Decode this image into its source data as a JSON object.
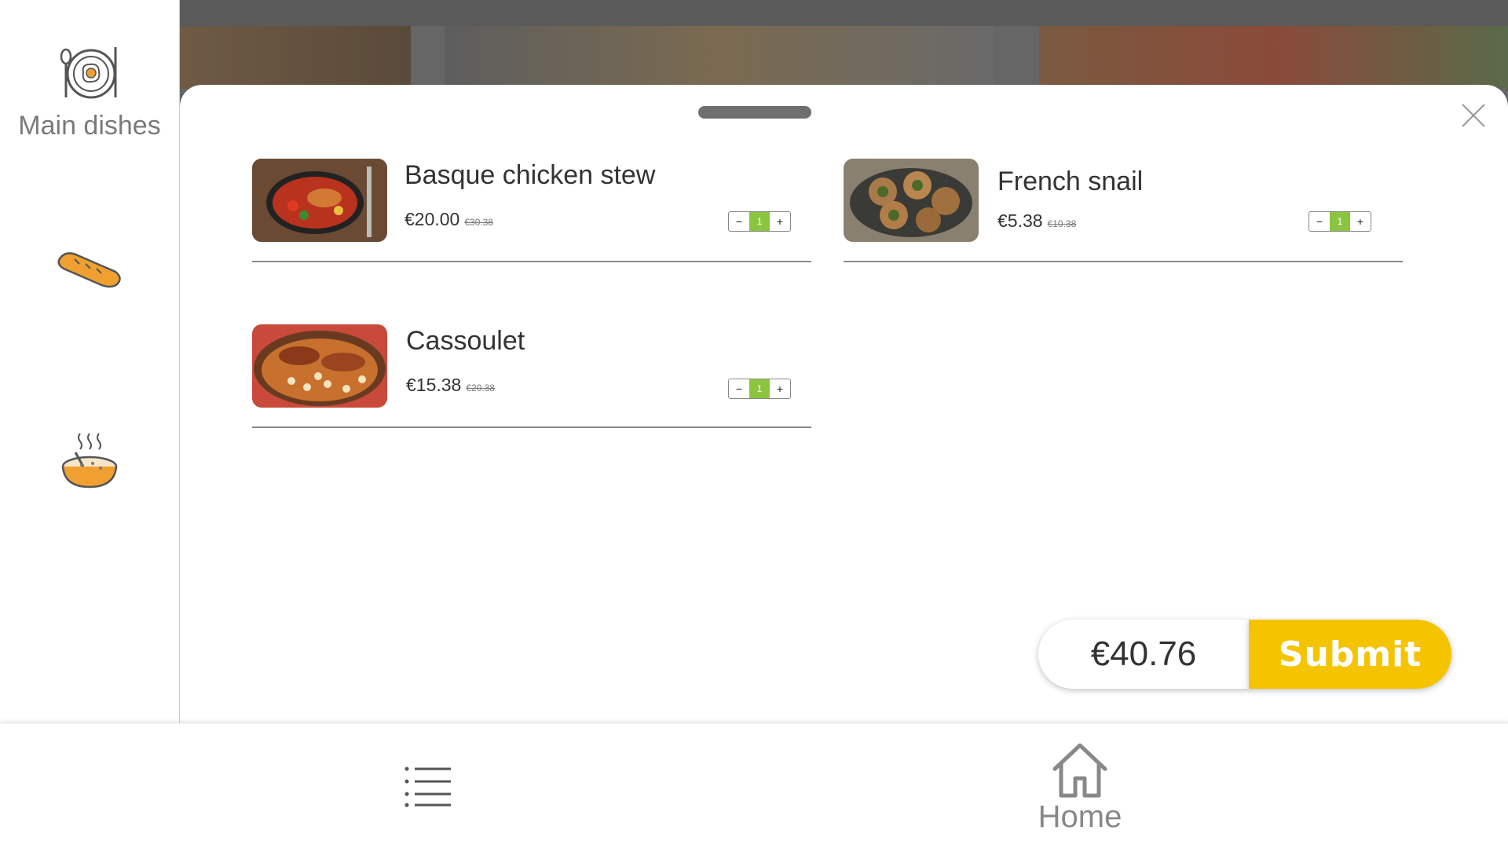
{
  "sidebar": {
    "categories": [
      {
        "label": "Main dishes",
        "icon": "plate-egg-icon"
      },
      {
        "label": "",
        "icon": "bread-icon"
      },
      {
        "label": "",
        "icon": "soup-bowl-icon"
      }
    ]
  },
  "cart": {
    "items": [
      {
        "name": "Basque chicken stew",
        "price": "€20.00",
        "old_price": "€30.38",
        "quantity": "1"
      },
      {
        "name": "French snail",
        "price": "€5.38",
        "old_price": "€10.38",
        "quantity": "1"
      },
      {
        "name": "Cassoulet",
        "price": "€15.38",
        "old_price": "€20.38",
        "quantity": "1"
      }
    ],
    "stepper": {
      "minus": "−",
      "plus": "+"
    },
    "total": "€40.76",
    "submit_label": "Submit"
  },
  "bottom_nav": {
    "home_label": "Home"
  },
  "colors": {
    "accent": "#f5c400",
    "quantity": "#8bc53f",
    "icon_orange": "#f0a030"
  }
}
